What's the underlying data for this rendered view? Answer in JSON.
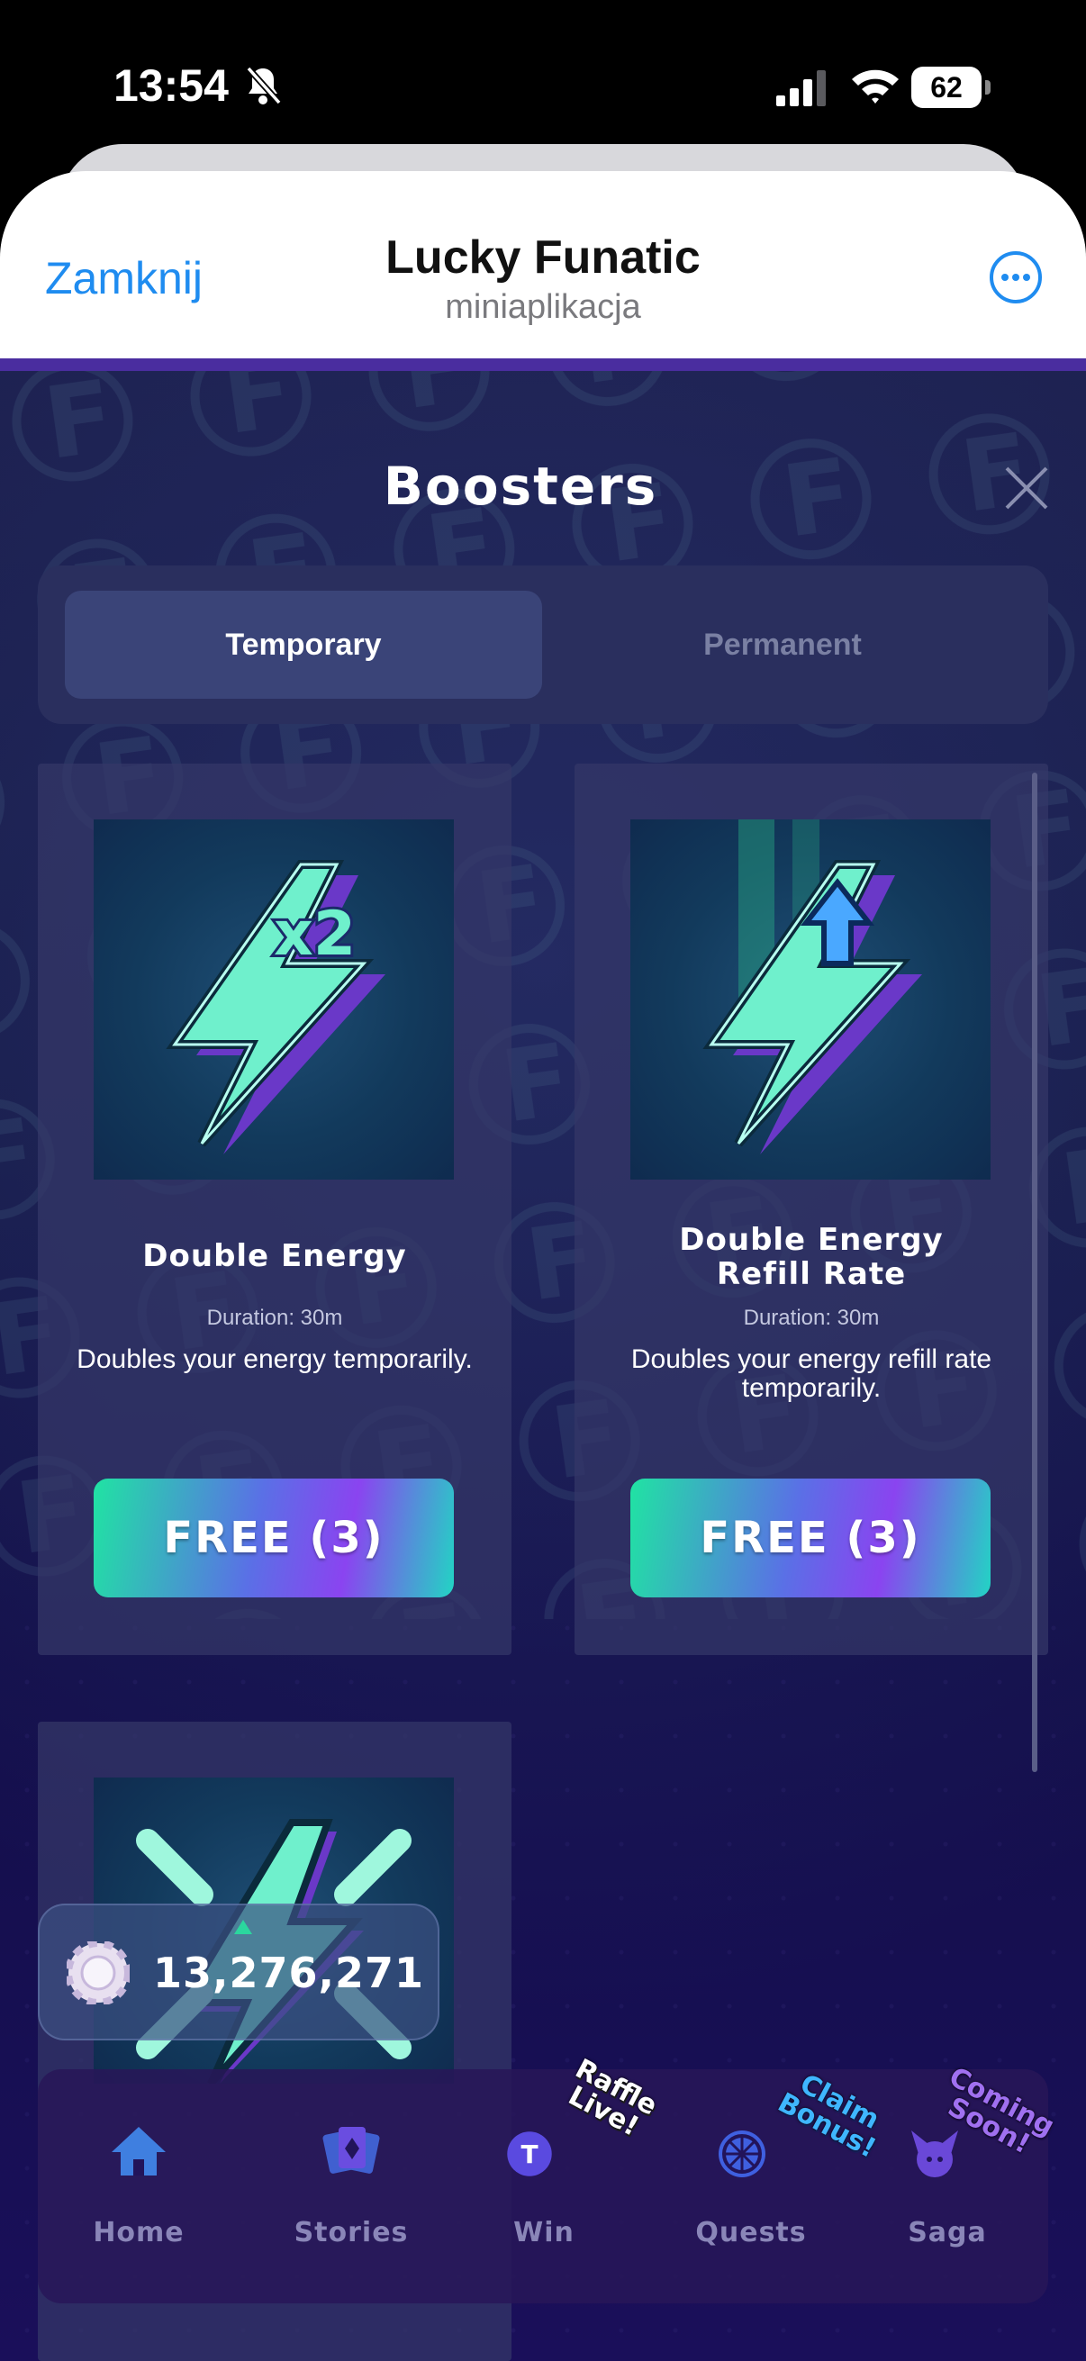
{
  "status_bar": {
    "time": "13:54",
    "battery": "62"
  },
  "header": {
    "close_label": "Zamknij",
    "title": "Lucky Funatic",
    "subtitle": "miniaplikacja"
  },
  "modal": {
    "title": "Boosters",
    "tabs": [
      {
        "label": "Temporary",
        "active": true
      },
      {
        "label": "Permanent",
        "active": false
      }
    ],
    "cards": [
      {
        "name": "Double Energy",
        "duration": "Duration: 30m",
        "description": "Doubles your energy temporarily.",
        "button": "FREE (3)",
        "badge": "x2"
      },
      {
        "name": "Double Energy Refill Rate",
        "duration": "Duration: 30m",
        "description": "Doubles your energy refill rate temporarily.",
        "button": "FREE (3)"
      }
    ]
  },
  "balance": {
    "value": "13,276,271"
  },
  "nav": {
    "items": [
      {
        "label": "Home",
        "icon": "home-icon"
      },
      {
        "label": "Stories",
        "icon": "stories-icon"
      },
      {
        "label": "Win",
        "icon": "win-icon",
        "badge": "Raffle Live!"
      },
      {
        "label": "Quests",
        "icon": "quests-icon",
        "badge": "Claim Bonus!"
      },
      {
        "label": "Saga",
        "icon": "saga-icon",
        "badge": "Coming Soon!"
      }
    ]
  },
  "colors": {
    "accent_blue": "#1f8cf0",
    "teal": "#2bd79e",
    "purple": "#8a44f0",
    "nav_label": "#8a86b8"
  }
}
